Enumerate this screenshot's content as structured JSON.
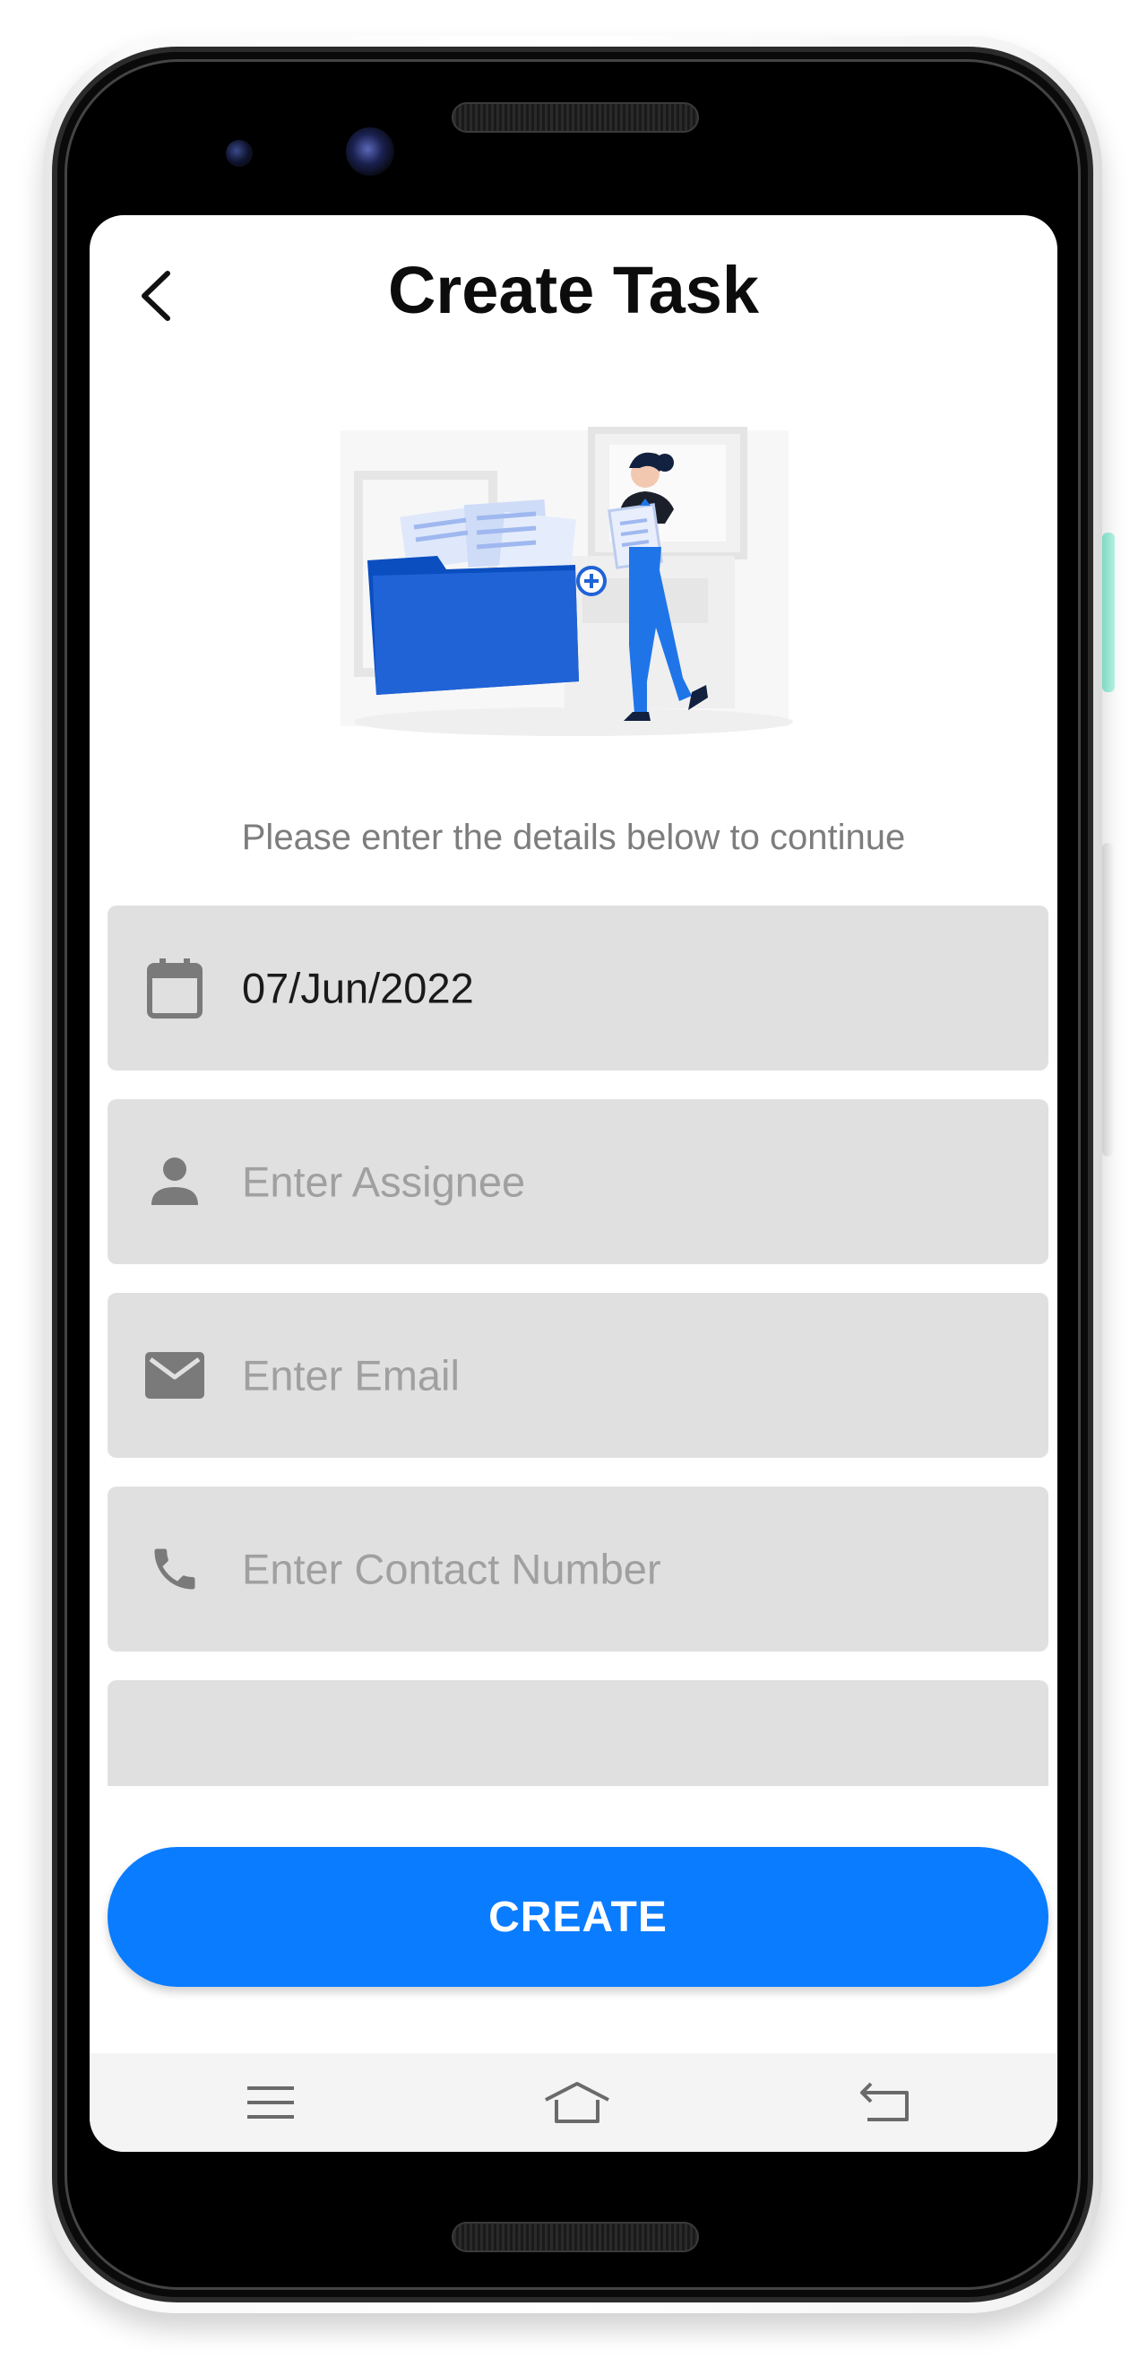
{
  "header": {
    "title": "Create Task",
    "back_icon": "chevron-left-icon"
  },
  "illustration": {
    "icon": "folder-documents-illustration"
  },
  "subtitle": "Please enter the details below to continue",
  "form": {
    "date": {
      "value": "07/Jun/2022",
      "icon": "calendar-icon"
    },
    "assignee": {
      "value": "",
      "placeholder": "Enter Assignee",
      "icon": "person-icon"
    },
    "email": {
      "value": "",
      "placeholder": "Enter Email",
      "icon": "mail-icon"
    },
    "contact": {
      "value": "",
      "placeholder": "Enter Contact Number",
      "icon": "phone-icon"
    }
  },
  "actions": {
    "create_label": "CREATE"
  },
  "nav": {
    "menu_icon": "menu-icon",
    "home_icon": "home-icon",
    "back_icon": "back-arrow-icon"
  },
  "colors": {
    "accent": "#0a7cff",
    "field_bg": "#e0e0e0",
    "placeholder": "#a0a0a0",
    "title": "#0c0c0c",
    "subtitle": "#7d7d7d",
    "illustration_blue": "#1f63d6"
  }
}
